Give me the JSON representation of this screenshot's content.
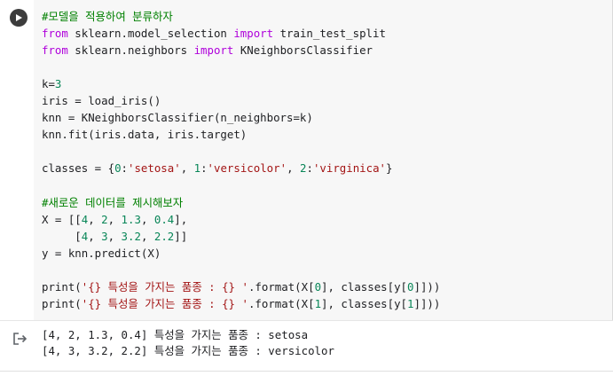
{
  "colors": {
    "keyword": "#af00db",
    "comment": "#008000",
    "string": "#a31515",
    "number": "#098658",
    "code_bg": "#f7f7f7"
  },
  "icons": {
    "run": "play-circle-icon",
    "output": "output-redirect-icon"
  },
  "code": {
    "comment1": "#모델을 적용하여 분류하자",
    "line_import1": {
      "from": "from",
      "module": " sklearn.model_selection ",
      "import": "import",
      "name": " train_test_split"
    },
    "line_import2": {
      "from": "from",
      "module": " sklearn.neighbors ",
      "import": "import",
      "name": " KNeighborsClassifier"
    },
    "line_k": {
      "text": "k=",
      "value": "3"
    },
    "line_iris": "iris = load_iris()",
    "line_knn": "knn = KNeighborsClassifier(n_neighbors=k)",
    "line_fit": "knn.fit(iris.data, iris.target)",
    "line_classes": {
      "prefix": "classes = {",
      "k0": "0",
      "sep0": ":",
      "v0": "'setosa'",
      "c0": ", ",
      "k1": "1",
      "sep1": ":",
      "v1": "'versicolor'",
      "c1": ", ",
      "k2": "2",
      "sep2": ":",
      "v2": "'virginica'",
      "suffix": "}"
    },
    "comment2": "#새로운 데이터를 제시해보자",
    "line_X1": {
      "prefix": "X = [[",
      "a": "4",
      "s1": ", ",
      "b": "2",
      "s2": ", ",
      "c": "1.3",
      "s3": ", ",
      "d": "0.4",
      "suffix": "],"
    },
    "line_X2": {
      "prefix": "     [",
      "a": "4",
      "s1": ", ",
      "b": "3",
      "s2": ", ",
      "c": "3.2",
      "s3": ", ",
      "d": "2.2",
      "suffix": "]]"
    },
    "line_y": "y = knn.predict(X)",
    "line_print1": {
      "fn": "print(",
      "str": "'{} 특성을 가지는 품종 : {} '",
      "rest1": ".format(X[",
      "i1": "0",
      "rest2": "], classes[y[",
      "i2": "0",
      "rest3": "]]))"
    },
    "line_print2": {
      "fn": "print(",
      "str": "'{} 특성을 가지는 품종 : {} '",
      "rest1": ".format(X[",
      "i1": "1",
      "rest2": "], classes[y[",
      "i2": "1",
      "rest3": "]]))"
    }
  },
  "output": {
    "line1": "[4, 2, 1.3, 0.4] 특성을 가지는 품종 : setosa",
    "line2": "[4, 3, 3.2, 2.2] 특성을 가지는 품종 : versicolor"
  }
}
